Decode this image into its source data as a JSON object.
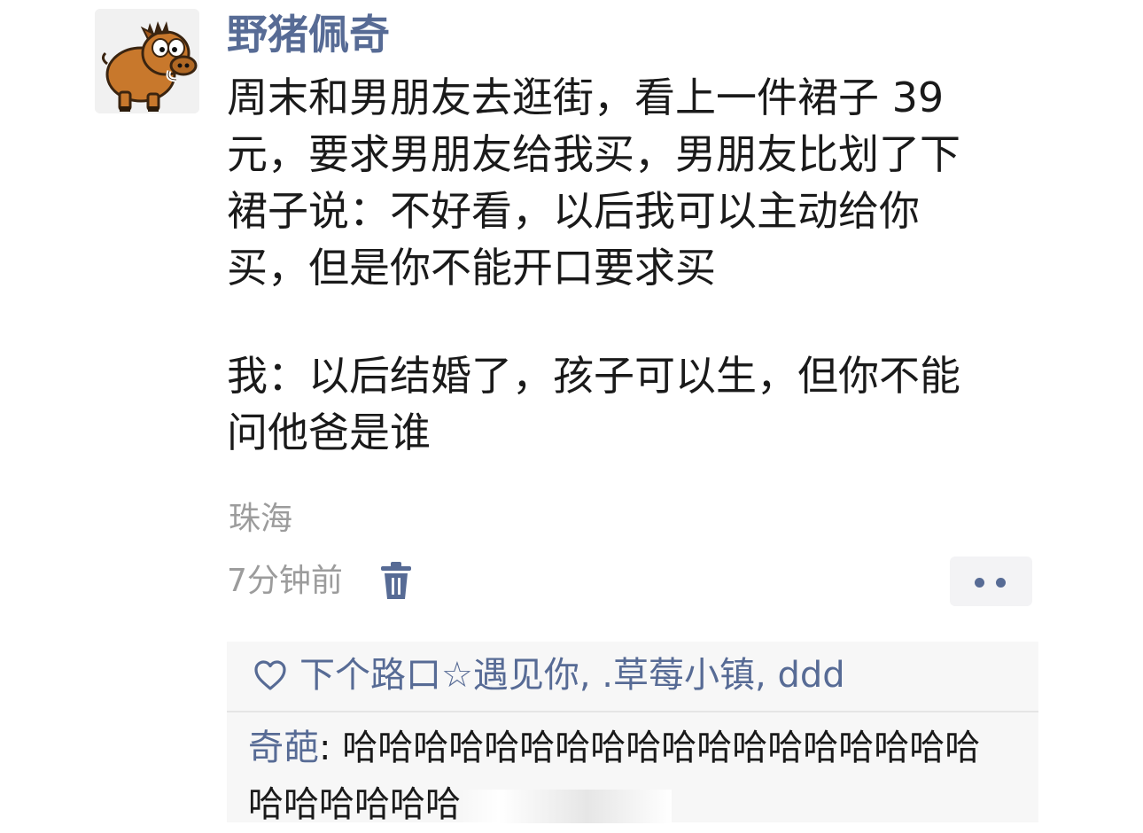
{
  "post": {
    "username": "野猪佩奇",
    "avatar_icon": "boar-cartoon-avatar",
    "text_lines": [
      "周末和男朋友去逛街，看上一件裙子 39",
      "元，要求男朋友给我买，男朋友比划了下",
      "裙子说：不好看，以后我可以主动给你",
      "买，但是你不能开口要求买",
      "我：以后结婚了，孩子可以生，但你不能",
      "问他爸是谁"
    ],
    "location": "珠海",
    "timestamp": "7分钟前",
    "delete_icon": "trash-icon",
    "more_icon": "more-dots-icon"
  },
  "interactions": {
    "like_icon": "heart-icon",
    "likers": [
      "下个路口☆遇见你",
      ".草莓小镇",
      "ddd"
    ],
    "separator": ", ",
    "comment": {
      "author": "奇葩",
      "colon": ": ",
      "text_line1": "哈哈哈哈哈哈哈哈哈哈哈哈哈哈哈哈哈哈",
      "text_line2": "哈哈哈哈哈哈"
    }
  },
  "colors": {
    "link": "#576b95",
    "text": "#1a1a1a",
    "meta": "#9c9c9c",
    "panel_bg": "#f7f7f7",
    "more_bg": "#f3f3f5"
  }
}
